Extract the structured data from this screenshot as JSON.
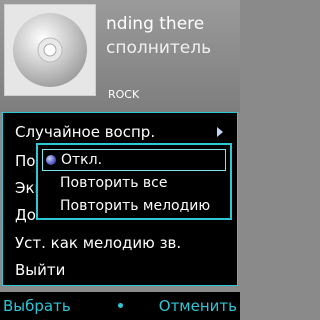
{
  "now_playing": {
    "title": "nding there",
    "artist": "сполнитель",
    "genre": "ROCK"
  },
  "menu": {
    "items": [
      "Случайное воспр.",
      "По",
      "Экв",
      "До",
      "Уст. как мелодию зв.",
      "Выйти"
    ]
  },
  "submenu": {
    "items": [
      "Откл.",
      "Повторить все",
      "Повторить мелодию"
    ],
    "selected_index": 0
  },
  "softkeys": {
    "left": "Выбрать",
    "right": "Отменить"
  },
  "colors": {
    "accent": "#2ec7d6",
    "menu_background": "#000000"
  }
}
